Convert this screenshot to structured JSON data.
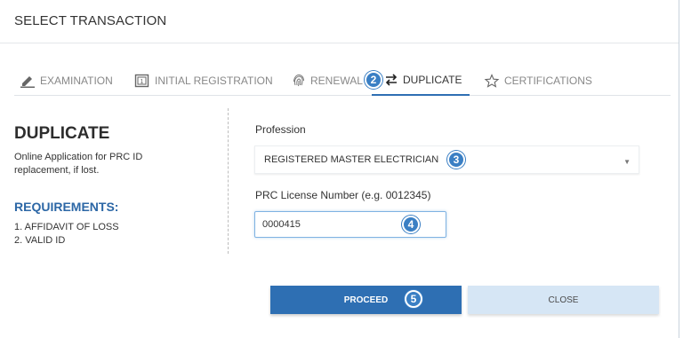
{
  "modal": {
    "title": "SELECT TRANSACTION"
  },
  "tabs": [
    {
      "label": "EXAMINATION",
      "icon": "pencil-icon"
    },
    {
      "label": "INITIAL REGISTRATION",
      "icon": "one-box-icon"
    },
    {
      "label": "RENEWAL",
      "icon": "fingerprint-icon"
    },
    {
      "label": "DUPLICATE",
      "icon": "swap-arrows-icon",
      "active": true
    },
    {
      "label": "CERTIFICATIONS",
      "icon": "star-outline-icon"
    }
  ],
  "badges": {
    "b2": "2",
    "b3": "3",
    "b4": "4",
    "b5": "5"
  },
  "left": {
    "title": "DUPLICATE",
    "description": "Online Application for PRC ID replacement, if lost.",
    "requirements_heading": "REQUIREMENTS:",
    "requirements": [
      "1. AFFIDAVIT OF LOSS",
      "2. VALID ID"
    ]
  },
  "form": {
    "profession_label": "Profession",
    "profession_value": "REGISTERED MASTER ELECTRICIAN",
    "license_label": "PRC License Number (e.g. 0012345)",
    "license_value": "0000415"
  },
  "buttons": {
    "proceed": "PROCEED",
    "close": "CLOSE"
  },
  "colors": {
    "accent": "#2e6fb3",
    "badge": "#3a7fc4",
    "close_bg": "#d6e6f5"
  }
}
